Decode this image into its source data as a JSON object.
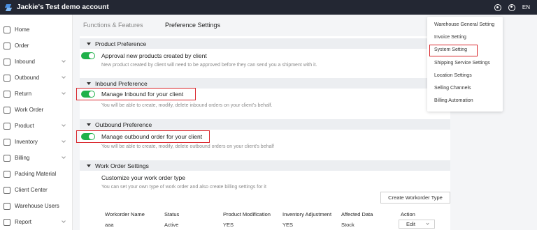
{
  "app": {
    "title": "Jackie's Test demo account",
    "lang": "EN"
  },
  "sidebar": {
    "items": [
      {
        "label": "Home",
        "icon": "home-icon",
        "has_chevron": false
      },
      {
        "label": "Order",
        "icon": "cart-icon",
        "has_chevron": false
      },
      {
        "label": "Inbound",
        "icon": "inbound-icon",
        "has_chevron": true
      },
      {
        "label": "Outbound",
        "icon": "outbound-icon",
        "has_chevron": true
      },
      {
        "label": "Return",
        "icon": "return-icon",
        "has_chevron": true
      },
      {
        "label": "Work Order",
        "icon": "work-order-icon",
        "has_chevron": false
      },
      {
        "label": "Product",
        "icon": "tag-icon",
        "has_chevron": true
      },
      {
        "label": "Inventory",
        "icon": "inventory-icon",
        "has_chevron": true
      },
      {
        "label": "Billing",
        "icon": "billing-icon",
        "has_chevron": true
      },
      {
        "label": "Packing Material",
        "icon": "packing-icon",
        "has_chevron": false
      },
      {
        "label": "Client Center",
        "icon": "client-icon",
        "has_chevron": false
      },
      {
        "label": "Warehouse Users",
        "icon": "users-icon",
        "has_chevron": false
      },
      {
        "label": "Report",
        "icon": "report-icon",
        "has_chevron": true
      }
    ]
  },
  "tabs": [
    {
      "label": "Functions & Features",
      "active": false
    },
    {
      "label": "Preference Settings",
      "active": true
    }
  ],
  "sections": {
    "product": {
      "title": "Product Preference",
      "option_title": "Approval new products created by client",
      "option_desc": "New product created by client will need to be approved before they can send you a shipment with it.",
      "enabled": true
    },
    "inbound": {
      "title": "Inbound Preference",
      "option_title": "Manage Inbound for your client",
      "option_desc": "You will be able to create, modify, delete inbound orders on your client's behalf.",
      "enabled": true
    },
    "outbound": {
      "title": "Outbound Preference",
      "option_title": "Manage outbound order for your client",
      "option_desc": "You will be able to create, modify, delete outbound orders on your client's behalf",
      "enabled": true
    },
    "work_order": {
      "title": "Work Order Settings",
      "option_title": "Customize your work order type",
      "option_desc": "You can set your own type of work order and also create billing settings for it",
      "create_button": "Create Workorder Type"
    }
  },
  "table": {
    "headers": [
      "Workorder Name",
      "Status",
      "Product Modification",
      "Inventory Adjustment",
      "Affected Data",
      "Action"
    ],
    "rows": [
      {
        "name": "aaa",
        "status": "Active",
        "product_mod": "YES",
        "inventory_adj": "YES",
        "affected": "Stock",
        "action": "Edit"
      }
    ]
  },
  "settings_menu": {
    "items": [
      "Warehouse General Setting",
      "Invoice Setting",
      "System Setting",
      "Shipping Service Settings",
      "Location Settings",
      "Selling Channels",
      "Billing Automation"
    ]
  },
  "colors": {
    "topbar": "#232733",
    "toggle_on": "#1fb14a",
    "highlight": "#d9262c"
  }
}
